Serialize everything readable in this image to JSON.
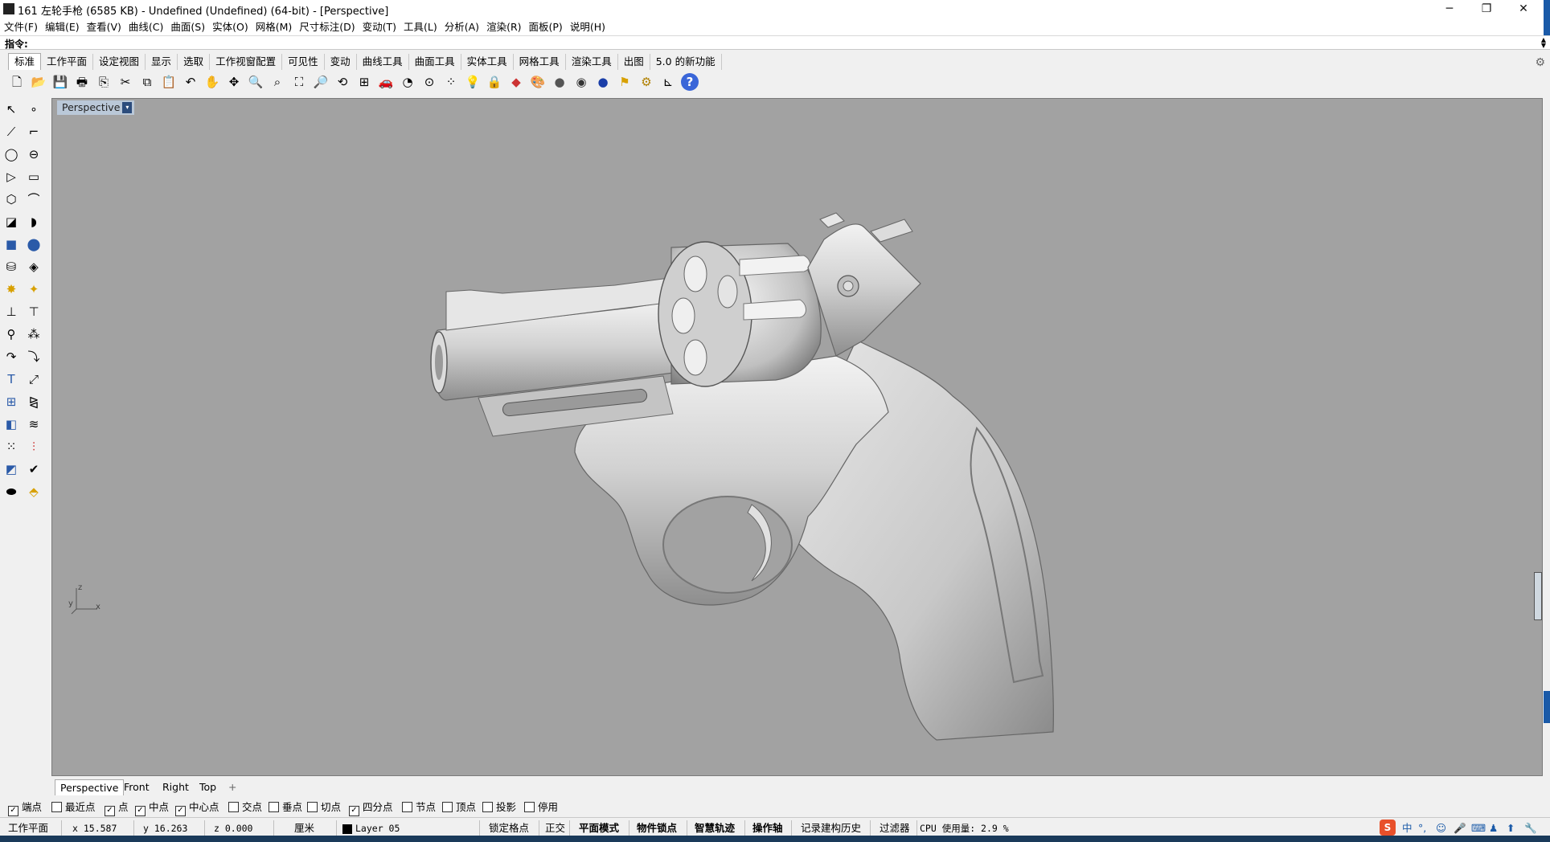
{
  "window": {
    "title": "161 左轮手枪 (6585 KB) - Undefined (Undefined) (64-bit) - [Perspective]",
    "minimize": "─",
    "maximize": "❐",
    "close": "✕"
  },
  "menu": [
    "文件(F)",
    "编辑(E)",
    "查看(V)",
    "曲线(C)",
    "曲面(S)",
    "实体(O)",
    "网格(M)",
    "尺寸标注(D)",
    "变动(T)",
    "工具(L)",
    "分析(A)",
    "渲染(R)",
    "面板(P)",
    "说明(H)"
  ],
  "command": {
    "label": "指令:"
  },
  "toolbar_tabs": [
    "标准",
    "工作平面",
    "设定视图",
    "显示",
    "选取",
    "工作视窗配置",
    "可见性",
    "变动",
    "曲线工具",
    "曲面工具",
    "实体工具",
    "网格工具",
    "渲染工具",
    "出图",
    "5.0 的新功能"
  ],
  "toolbar_icons": [
    "new-file-icon",
    "open-folder-icon",
    "save-icon",
    "print-icon",
    "import-icon",
    "cut-icon",
    "copy-icon",
    "paste-icon",
    "undo-icon",
    "pan-hand-icon",
    "move-view-icon",
    "zoom-window-icon",
    "zoom-dynamic-icon",
    "zoom-extents-icon",
    "zoom-selected-icon",
    "rotate-view-icon",
    "four-viewports-icon",
    "car-icon",
    "car-render-icon",
    "osnap-icon",
    "points-icon",
    "light-icon",
    "lock-icon",
    "layer-icon",
    "color-wheel-icon",
    "shaded-sphere-icon",
    "rendered-sphere-icon",
    "blue-sphere-icon",
    "render-flag-icon",
    "options-gear-icon",
    "dimension-icon",
    "help-icon"
  ],
  "viewport": {
    "name": "Perspective",
    "dropdown": "▾"
  },
  "axis": {
    "z": "z",
    "y": "y",
    "x": "x"
  },
  "view_tabs": [
    "Perspective",
    "Front",
    "Right",
    "Top"
  ],
  "add_tab": "+",
  "osnaps": [
    {
      "label": "端点",
      "checked": true
    },
    {
      "label": "最近点",
      "checked": false
    },
    {
      "label": "点",
      "checked": true
    },
    {
      "label": "中点",
      "checked": true
    },
    {
      "label": "中心点",
      "checked": true
    },
    {
      "label": "交点",
      "checked": false
    },
    {
      "label": "垂点",
      "checked": false
    },
    {
      "label": "切点",
      "checked": false
    },
    {
      "label": "四分点",
      "checked": true
    },
    {
      "label": "节点",
      "checked": false
    },
    {
      "label": "顶点",
      "checked": false
    },
    {
      "label": "投影",
      "checked": false
    },
    {
      "label": "停用",
      "checked": false
    }
  ],
  "status": {
    "cplane": "工作平面",
    "x": "x 15.587",
    "y": "y 16.263",
    "z": "z 0.000",
    "units": "厘米",
    "layer": "Layer 05",
    "grid_snap": "锁定格点",
    "ortho": "正交",
    "planar": "平面模式",
    "osnap": "物件锁点",
    "smarttrack": "智慧轨迹",
    "gumball": "操作轴",
    "history": "记录建构历史",
    "filter": "过滤器",
    "cpu": "CPU 使用量: 2.9 %"
  },
  "tray": {
    "ime": "中"
  },
  "colors": {
    "viewport_bg": "#a2a2a2",
    "model_gray": "#d6d6d6",
    "active_title": "#bac8d8"
  }
}
